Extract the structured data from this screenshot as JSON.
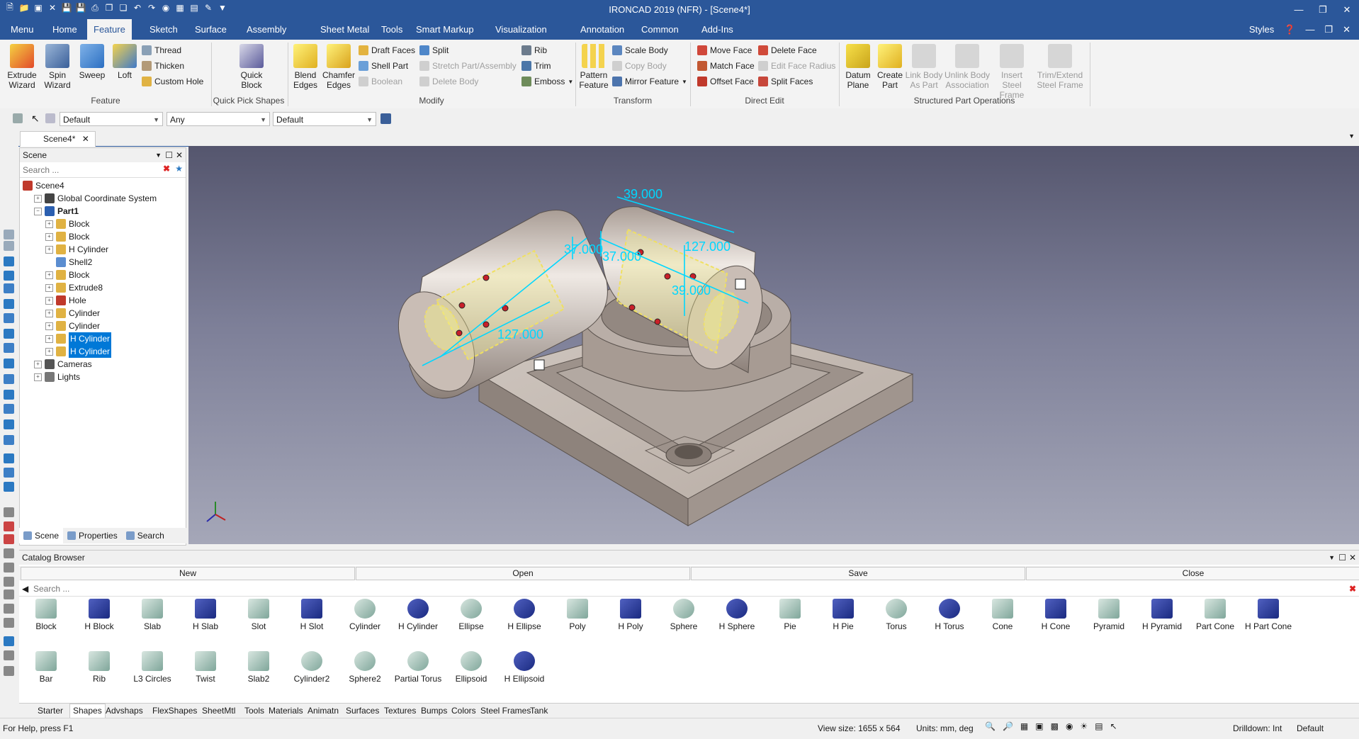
{
  "window": {
    "title": "IRONCAD 2019 (NFR) - [Scene4*]"
  },
  "quick_access": [
    "new-icon",
    "open-icon",
    "pdf-icon",
    "close-doc-icon",
    "save-icon",
    "save-as-icon",
    "print-icon",
    "copy-icon",
    "paste-icon",
    "undo-icon",
    "redo-icon",
    "globe-icon",
    "grid-icon",
    "table-icon",
    "brush-icon",
    "dropdown-icon"
  ],
  "ribbon_tabs": [
    "Menu",
    "Home",
    "Feature",
    "Sketch",
    "Surface",
    "Assembly",
    "Sheet Metal",
    "Tools",
    "Smart Markup",
    "Visualization",
    "Annotation",
    "Common",
    "Add-Ins"
  ],
  "active_tab": "Feature",
  "styles_label": "Styles",
  "ribbon": {
    "feature_group": {
      "label": "Feature",
      "extrude": "Extrude Wizard",
      "spin": "Spin Wizard",
      "sweep": "Sweep",
      "loft": "Loft",
      "thread": "Thread",
      "thicken": "Thicken",
      "custom_hole": "Custom Hole"
    },
    "quick_pick": {
      "label": "Quick Pick Shapes",
      "quick_block": "Quick Block"
    },
    "modify": {
      "label": "Modify",
      "blend": "Blend Edges",
      "chamfer": "Chamfer Edges",
      "draft": "Draft Faces",
      "shell": "Shell Part",
      "boolean": "Boolean",
      "split": "Split",
      "stretch": "Stretch Part/Assembly",
      "delete_body": "Delete Body",
      "rib": "Rib",
      "trim": "Trim",
      "emboss": "Emboss"
    },
    "transform": {
      "label": "Transform",
      "pattern": "Pattern Feature",
      "scale": "Scale Body",
      "copy": "Copy Body",
      "mirror": "Mirror Feature"
    },
    "direct_edit": {
      "label": "Direct Edit",
      "move_face": "Move Face",
      "match_face": "Match Face",
      "offset_face": "Offset Face",
      "delete_face": "Delete Face",
      "edit_face_radius": "Edit Face Radius",
      "split_faces": "Split Faces"
    },
    "structured": {
      "label": "Structured Part Operations",
      "datum": "Datum Plane",
      "create_part": "Create Part",
      "link_body": "Link Body As Part",
      "unlink_body": "Unlink Body Association",
      "insert_steel": "Insert Steel Frame",
      "trim_steel": "Trim/Extend Steel Frame"
    }
  },
  "selection_toolbar": {
    "combo1": "Default",
    "combo2": "Any",
    "combo3": "Default"
  },
  "doc_tab": "Scene4*",
  "scene_panel": {
    "title": "Scene",
    "search_placeholder": "Search ...",
    "tree": [
      {
        "label": "Scene4",
        "level": 0,
        "icon": "scene-icon"
      },
      {
        "label": "Global Coordinate System",
        "level": 1,
        "icon": "axes-icon"
      },
      {
        "label": "Part1",
        "level": 1,
        "icon": "part-icon"
      },
      {
        "label": "Block",
        "level": 2,
        "icon": "block-icon"
      },
      {
        "label": "Block",
        "level": 2,
        "icon": "block-icon"
      },
      {
        "label": "H Cylinder",
        "level": 2,
        "icon": "block-icon"
      },
      {
        "label": "Shell2",
        "level": 2,
        "icon": "shell-icon"
      },
      {
        "label": "Block",
        "level": 2,
        "icon": "block-icon"
      },
      {
        "label": "Extrude8",
        "level": 2,
        "icon": "block-icon"
      },
      {
        "label": "Hole",
        "level": 2,
        "icon": "hole-icon"
      },
      {
        "label": "Cylinder",
        "level": 2,
        "icon": "block-icon"
      },
      {
        "label": "Cylinder",
        "level": 2,
        "icon": "block-icon"
      },
      {
        "label": "H Cylinder",
        "level": 2,
        "icon": "block-icon"
      },
      {
        "label": "H Cylinder",
        "level": 2,
        "icon": "block-icon"
      },
      {
        "label": "Cameras",
        "level": 1,
        "icon": "camera-icon"
      },
      {
        "label": "Lights",
        "level": 1,
        "icon": "light-icon"
      }
    ],
    "footer_tabs": [
      "Scene",
      "Properties",
      "Search"
    ]
  },
  "viewport": {
    "dimensions": [
      "39.000",
      "127.000",
      "37.000",
      "37.000",
      "39.000",
      "127.000"
    ],
    "dim_labels": {
      "top_right": "39.000",
      "right_len": "127.000",
      "left_len": "127.000",
      "center_a": "37.000",
      "center_b": "37.000",
      "right_mid": "39.000"
    },
    "colors": {
      "dimension": "#00d7ff",
      "part": "#c8beb6",
      "highlight": "#e8e8a0"
    }
  },
  "catalog": {
    "title": "Catalog Browser",
    "buttons": [
      "New",
      "Open",
      "Save",
      "Close"
    ],
    "search_placeholder": "Search ...",
    "row1": [
      "Block",
      "H Block",
      "Slab",
      "H Slab",
      "Slot",
      "H Slot",
      "Cylinder",
      "H Cylinder",
      "Ellipse",
      "H Ellipse",
      "Poly",
      "H Poly",
      "Sphere",
      "H Sphere",
      "Pie",
      "H Pie",
      "Torus",
      "H Torus",
      "Cone",
      "H Cone",
      "Pyramid",
      "H Pyramid",
      "Part Cone",
      "H Part Cone"
    ],
    "row2": [
      "Bar",
      "Rib",
      "L3 Circles",
      "Twist",
      "Slab2",
      "Cylinder2",
      "Sphere2",
      "Partial Torus",
      "Ellipsoid",
      "H Ellipsoid"
    ],
    "tabs": [
      "Starter",
      "Shapes",
      "Advshaps",
      "FlexShapes",
      "SheetMtl",
      "Tools",
      "Materials",
      "Animatn",
      "Surfaces",
      "Textures",
      "Bumps",
      "Colors",
      "Steel Frames",
      "Tank"
    ],
    "active_tab": "Shapes"
  },
  "status": {
    "help": "For Help, press F1",
    "view_size": "View size: 1655 x 564",
    "units": "Units: mm, deg",
    "drilldown": "Drilldown: Int",
    "style": "Default"
  }
}
